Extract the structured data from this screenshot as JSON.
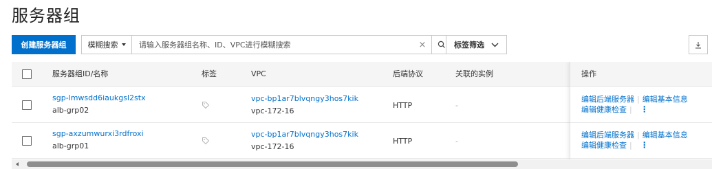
{
  "page_title": "服务器组",
  "toolbar": {
    "create_label": "创建服务器组",
    "search_mode_label": "模糊搜索",
    "search_placeholder": "请输入服务器组名称、ID、VPC进行模糊搜索",
    "clear_glyph": "×",
    "tag_filter_label": "标签筛选"
  },
  "table": {
    "headers": {
      "id_name": "服务器组ID/名称",
      "tags": "标签",
      "vpc": "VPC",
      "protocol": "后端协议",
      "instances": "关联的实例",
      "actions": "操作"
    },
    "rows": [
      {
        "id": "sgp-lmwsdd6iaukgsl2stx",
        "name": "alb-grp02",
        "vpc_id": "vpc-bp1ar7blvqngy3hos7kik",
        "vpc_name": "vpc-172-16",
        "protocol": "HTTP",
        "instances": "-",
        "actions": {
          "edit_backend": "编辑后端服务器",
          "edit_basic": "编辑基本信息",
          "edit_health": "编辑健康检查"
        }
      },
      {
        "id": "sgp-axzumwurxi3rdfroxi",
        "name": "alb-grp01",
        "vpc_id": "vpc-bp1ar7blvqngy3hos7kik",
        "vpc_name": "vpc-172-16",
        "protocol": "HTTP",
        "instances": "-",
        "actions": {
          "edit_backend": "编辑后端服务器",
          "edit_basic": "编辑基本信息",
          "edit_health": "编辑健康检查"
        }
      }
    ]
  },
  "colors": {
    "primary": "#0070cc",
    "header_bg": "#f5f5f6",
    "border": "#c8c8c8"
  },
  "icons": [
    "search-icon",
    "chevron-down-icon",
    "download-icon",
    "tag-icon",
    "more-icon",
    "close-icon",
    "caret-down-icon",
    "scroll-left-icon"
  ]
}
